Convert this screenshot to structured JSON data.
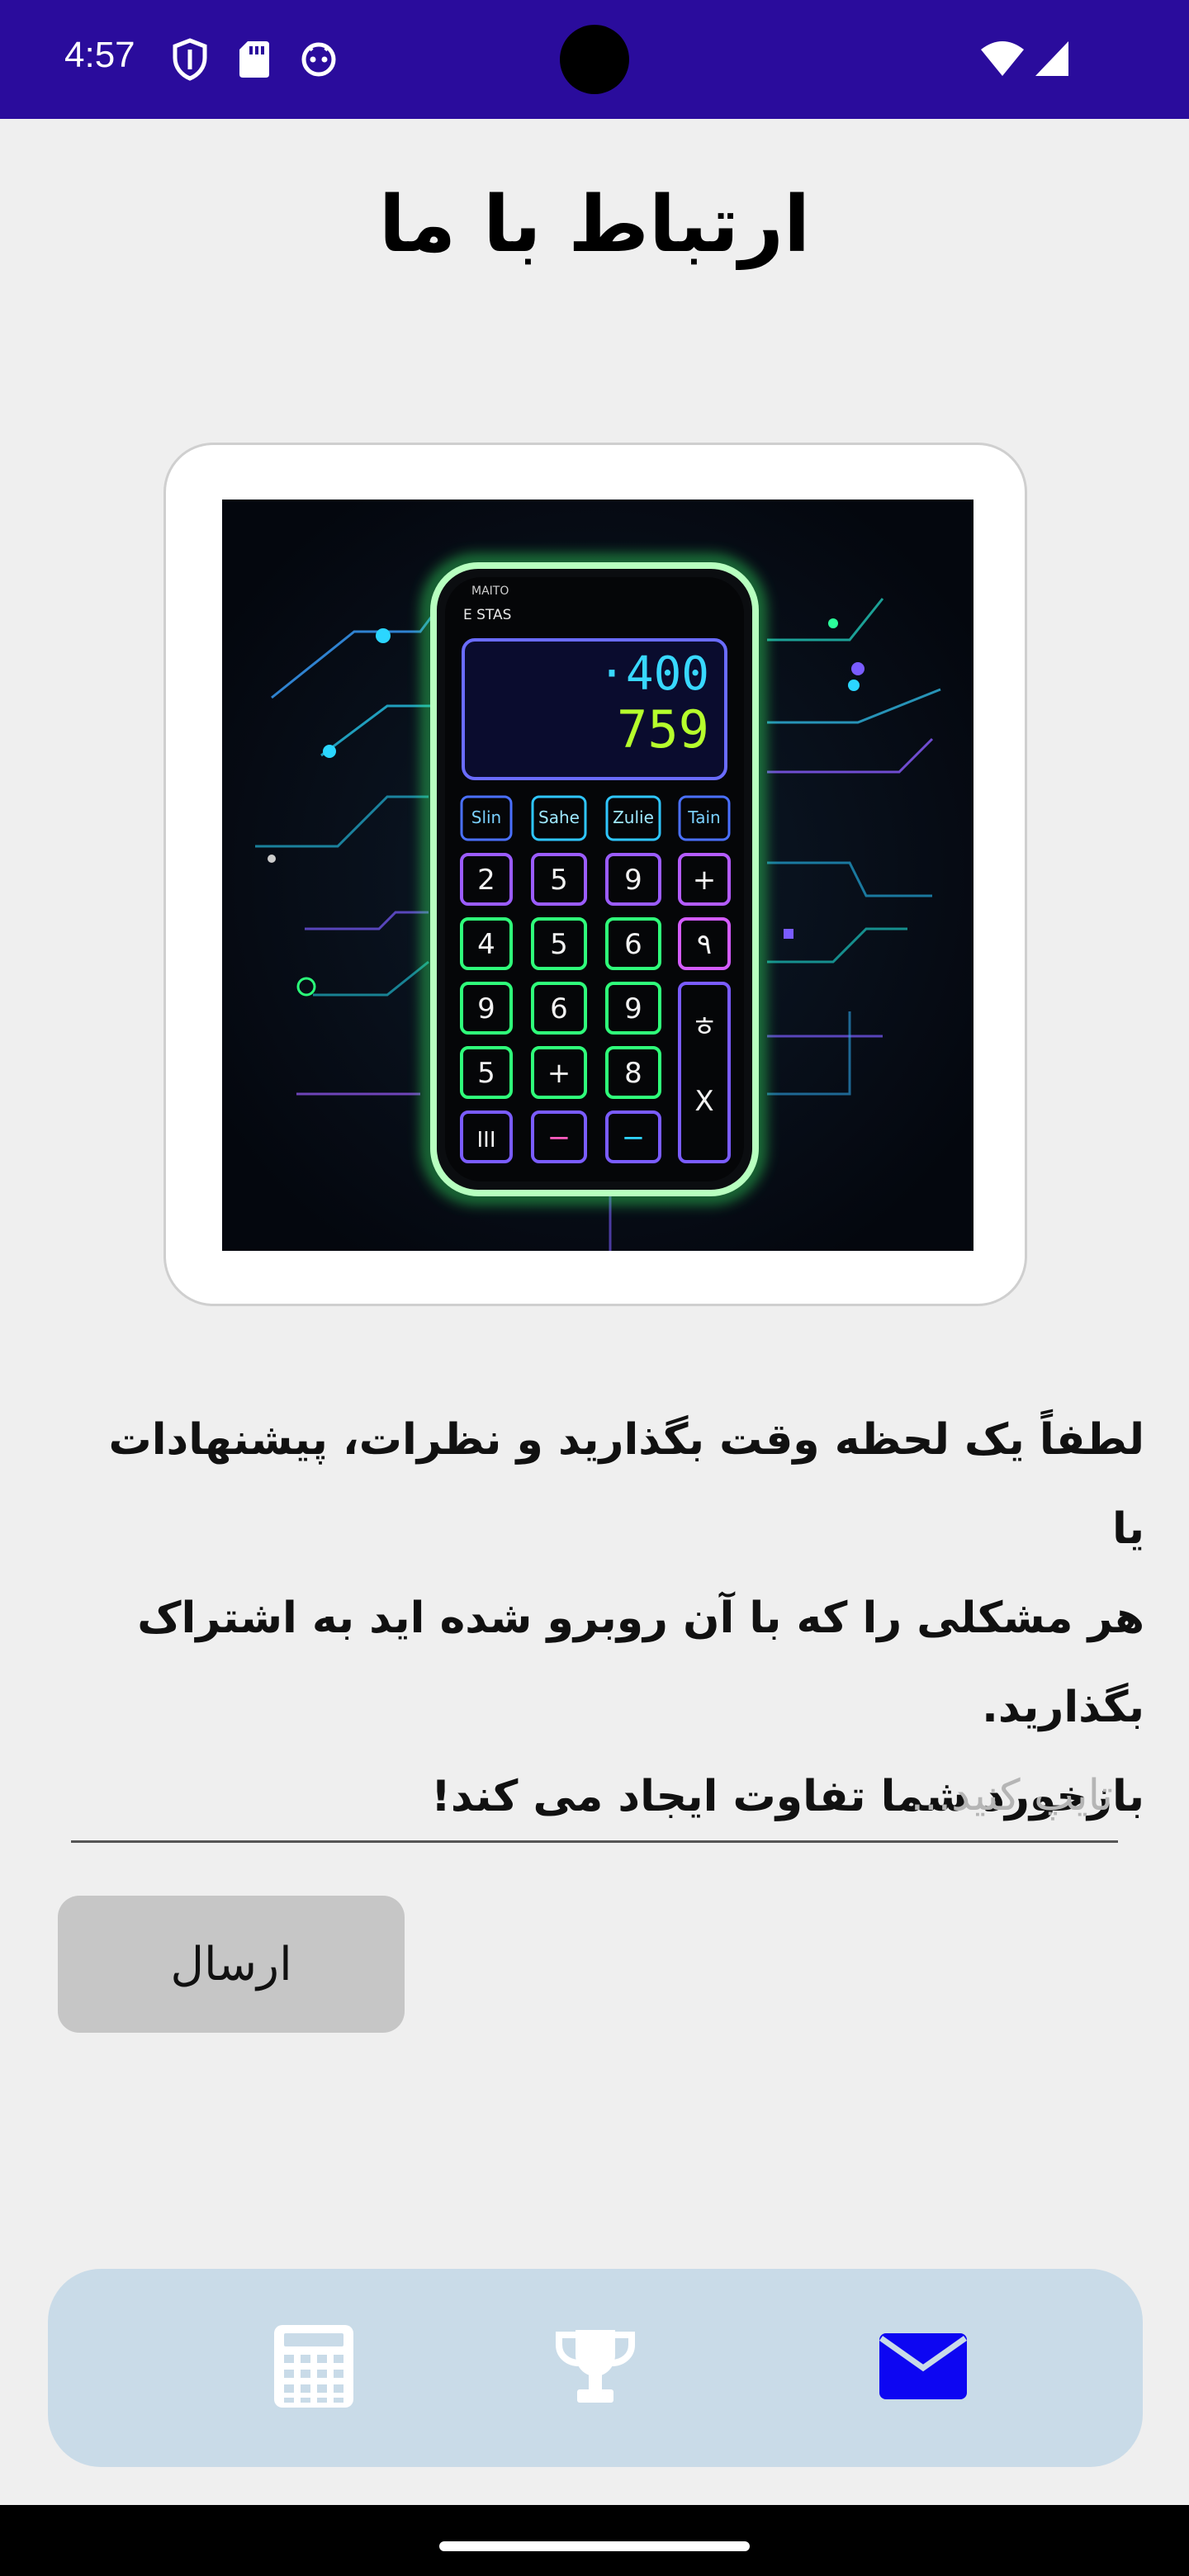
{
  "status_bar": {
    "time": "4:57",
    "icons": [
      "shield-icon",
      "sd-card-icon",
      "android-icon",
      "wifi-icon",
      "cell-signal-icon"
    ],
    "background": "#2a0c9c"
  },
  "page": {
    "title": "ارتباط با ما",
    "description_lines": [
      "لطفاً یک لحظه وقت بگذارید و نظرات، پیشنهادات یا",
      "هر مشکلی را که با آن روبرو شده اید به اشتراک بگذارید.",
      "بازخورد شما تفاوت ایجاد می کند!"
    ]
  },
  "image": {
    "subject": "neon calculator phone illustration",
    "screen_top": "·400",
    "screen_bottom": "759",
    "phone_header_left": "MAITO",
    "phone_header_label": "E STAS",
    "function_keys": [
      "Slin",
      "Sahe",
      "Zulie",
      "Tain"
    ],
    "rows": [
      [
        "2",
        "5",
        "9",
        "+"
      ],
      [
        "4",
        "5",
        "6",
        "٩"
      ],
      [
        "9",
        "6",
        "9",
        "ㅎ"
      ],
      [
        "5",
        "+",
        "8",
        "X"
      ],
      [
        "III",
        "−",
        "−",
        ""
      ]
    ]
  },
  "form": {
    "input_value": "",
    "input_placeholder": "تایپ کنید...",
    "submit_label": "ارسال"
  },
  "bottom_nav": {
    "items": [
      {
        "name": "calculator",
        "icon": "calculator-icon",
        "active": false
      },
      {
        "name": "leaderboard",
        "icon": "trophy-icon",
        "active": false
      },
      {
        "name": "contact",
        "icon": "envelope-icon",
        "active": true
      }
    ],
    "inactive_color": "#ffffff",
    "active_color": "#0d06f2",
    "background": "#c9dbe8"
  }
}
